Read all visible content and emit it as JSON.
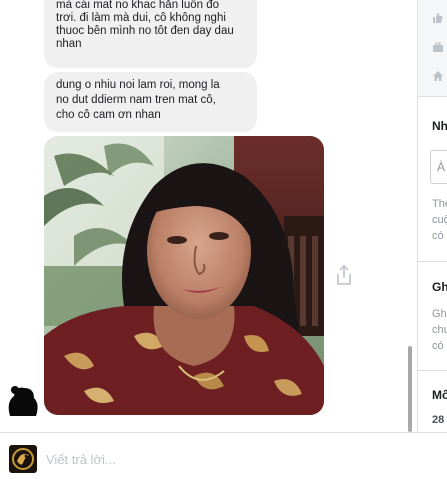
{
  "messages": [
    {
      "lines": [
        "mà cái mat no khac hẳn luôn đo",
        "trơi. đi làm mà dui, cô không nghi",
        "thuoc bên mình no tôt đen day dau",
        "nhan"
      ]
    },
    {
      "lines": [
        "dung o nhiu noi lam roi, mong la",
        "no dut ddierm nam tren mat cô,",
        "cho cô cam ơn nhan"
      ]
    }
  ],
  "sidebar": {
    "icons": [
      "thumbs-up-icon",
      "briefcase-icon",
      "home-icon"
    ],
    "sections": [
      {
        "title": "Nh",
        "search_text": "À",
        "body": [
          "The",
          "cuộ",
          "có"
        ]
      },
      {
        "title": "Gh",
        "body": [
          "Gh",
          "chư",
          "có"
        ]
      },
      {
        "title": "Mố",
        "number": "28"
      }
    ]
  },
  "composer": {
    "placeholder": "Viết trả lời..."
  }
}
